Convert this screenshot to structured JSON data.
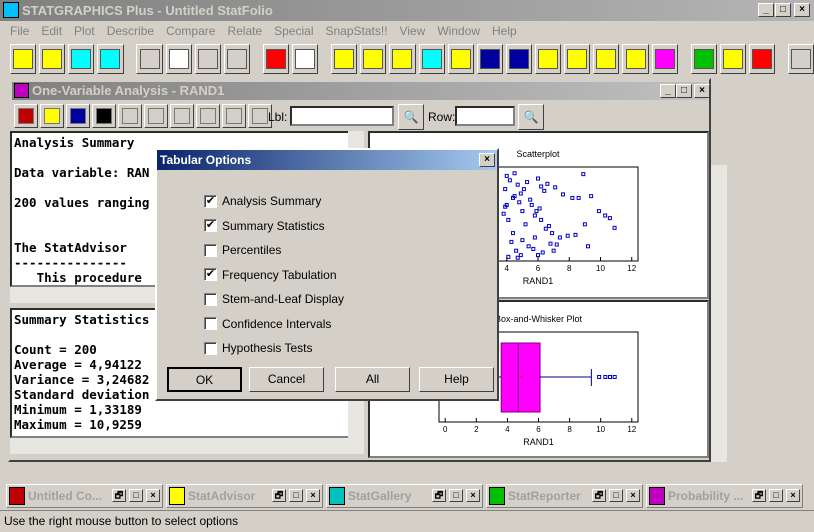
{
  "app": {
    "title": "STATGRAPHICS Plus - Untitled StatFolio"
  },
  "menu": [
    "File",
    "Edit",
    "Plot",
    "Describe",
    "Compare",
    "Relate",
    "Special",
    "SnapStats!!",
    "View",
    "Window",
    "Help"
  ],
  "child": {
    "title": "One-Variable Analysis - RAND1",
    "lbl_label": "Lbl:",
    "row_label": "Row:",
    "lbl_value": "",
    "row_value": ""
  },
  "pane1_lines": [
    "Analysis Summary",
    "",
    "Data variable: RAN",
    "",
    "200 values ranging",
    "",
    "",
    "The StatAdvisor",
    "---------------",
    "   This procedure"
  ],
  "pane2_lines": [
    "Summary Statistics",
    "",
    "Count = 200",
    "Average = 4,94122",
    "Variance = 3,24682",
    "Standard deviation",
    "Minimum = 1,33189",
    "Maximum = 10,9259"
  ],
  "dialog": {
    "title": "Tabular Options",
    "options": [
      {
        "label": "Analysis Summary",
        "checked": true
      },
      {
        "label": "Summary Statistics",
        "checked": true
      },
      {
        "label": "Percentiles",
        "checked": false
      },
      {
        "label": "Frequency Tabulation",
        "checked": true
      },
      {
        "label": "Stem-and-Leaf Display",
        "checked": false
      },
      {
        "label": "Confidence Intervals",
        "checked": false
      },
      {
        "label": "Hypothesis Tests",
        "checked": false
      }
    ],
    "buttons": [
      "OK",
      "Cancel",
      "All",
      "Help"
    ]
  },
  "chart_data": [
    {
      "type": "scatter",
      "title": "Scatterplot",
      "xlabel": "RAND1",
      "xlim": [
        -0.4,
        12.4
      ],
      "xticks": [
        0,
        2,
        4,
        6,
        8,
        10,
        12
      ],
      "color": "#0000c0",
      "x": [
        4.0,
        4.2,
        4.5,
        4.7,
        5.1,
        5.3,
        6.0,
        6.2,
        6.4,
        6.6,
        7.1,
        7.6,
        8.2,
        8.6,
        8.9,
        9.4,
        9.9,
        10.3,
        10.6,
        10.9,
        3.9,
        4.1,
        4.4,
        4.8,
        5.0,
        5.2,
        5.6,
        5.8,
        6.1,
        6.5,
        6.9,
        7.4,
        7.9,
        8.4,
        9.0,
        9.2,
        4.3,
        4.6,
        4.9,
        5.4,
        5.7,
        6.3,
        6.8,
        7.2,
        3.8,
        4.0,
        4.5,
        4.9,
        5.5,
        5.9,
        6.2,
        6.7,
        4.1,
        4.7,
        5.0,
        5.8,
        6.0,
        7.0,
        3.9,
        4.4
      ],
      "y": [
        0.95,
        0.9,
        0.98,
        0.85,
        0.8,
        0.88,
        0.92,
        0.83,
        0.78,
        0.86,
        0.82,
        0.74,
        0.7,
        0.7,
        0.97,
        0.72,
        0.55,
        0.5,
        0.47,
        0.36,
        0.6,
        0.45,
        0.3,
        0.65,
        0.55,
        0.4,
        0.62,
        0.5,
        0.58,
        0.35,
        0.3,
        0.25,
        0.27,
        0.28,
        0.4,
        0.15,
        0.2,
        0.1,
        0.05,
        0.15,
        0.12,
        0.08,
        0.18,
        0.17,
        0.52,
        0.62,
        0.72,
        0.75,
        0.68,
        0.55,
        0.45,
        0.38,
        0.03,
        0.02,
        0.22,
        0.25,
        0.05,
        0.1,
        0.8,
        0.7
      ]
    },
    {
      "type": "box",
      "title": "Box-and-Whisker Plot",
      "xlabel": "RAND1",
      "xlim": [
        -0.4,
        12.4
      ],
      "xticks": [
        0,
        2,
        4,
        6,
        8,
        10,
        12
      ],
      "color": "#ff00ff",
      "min": 1.33,
      "q1": 3.6,
      "median": 4.7,
      "mean": 4.94,
      "q3": 6.1,
      "upper_whisker": 9.4,
      "outliers": [
        9.9,
        10.3,
        10.6,
        10.9
      ]
    }
  ],
  "taskbar": [
    {
      "label": "Untitled Co...",
      "color": "#c00000"
    },
    {
      "label": "StatAdvisor",
      "color": "#ffff00"
    },
    {
      "label": "StatGallery",
      "color": "#00c0c0"
    },
    {
      "label": "StatReporter",
      "color": "#00c000"
    },
    {
      "label": "Probability ...",
      "color": "#c000c0"
    }
  ],
  "status": "Use the right mouse button to select options"
}
